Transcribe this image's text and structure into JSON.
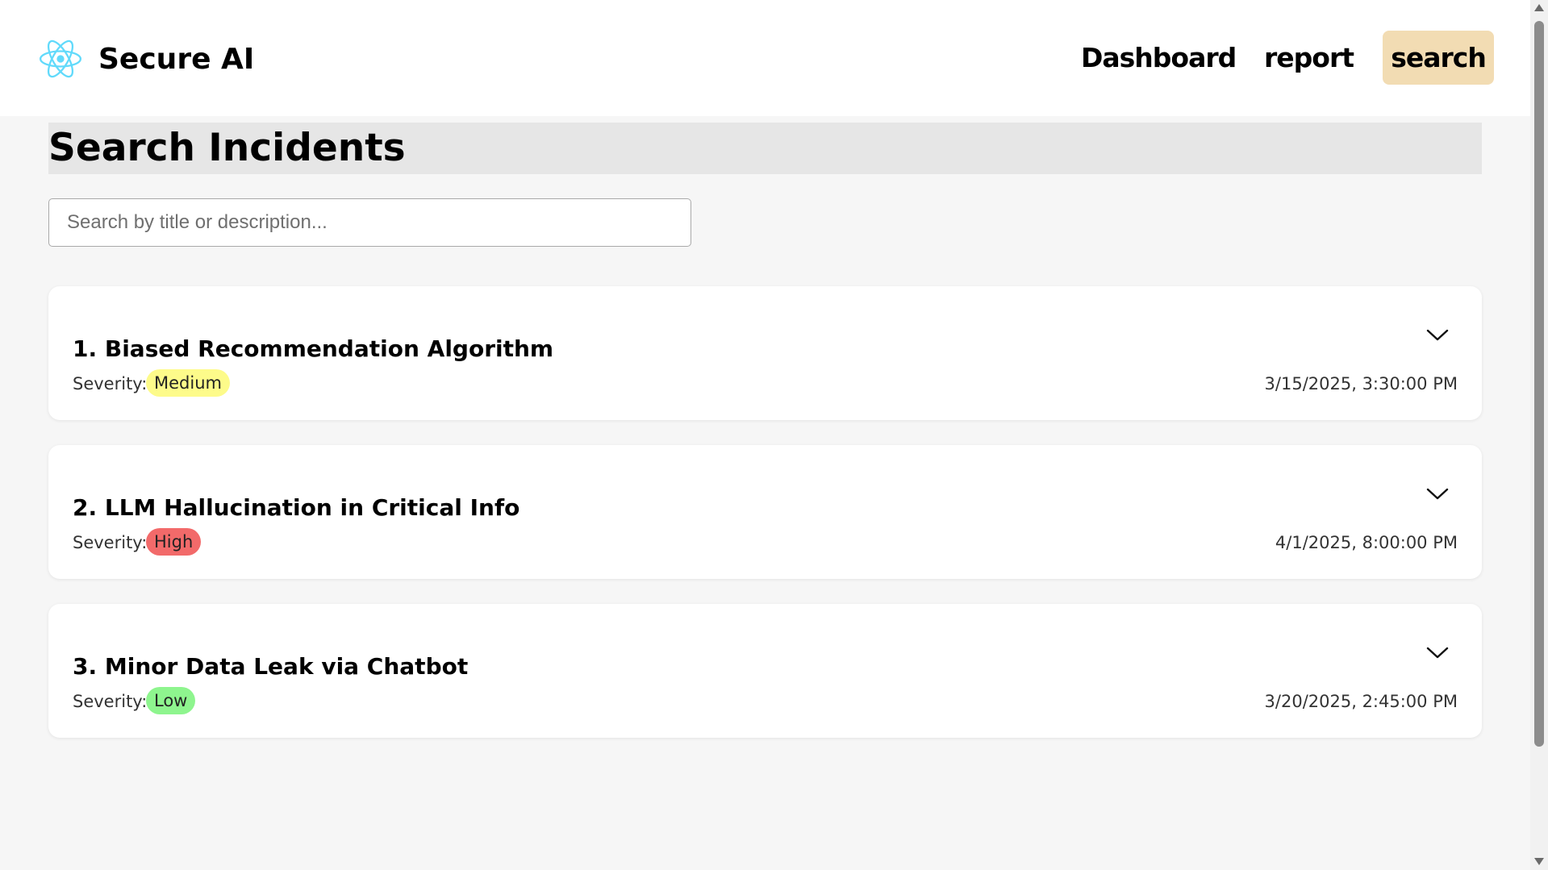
{
  "header": {
    "brand": "Secure AI",
    "logo_icon": "react-atom-icon",
    "logo_color": "#61dafb",
    "nav": {
      "dashboard": "Dashboard",
      "report": "report",
      "search": "search",
      "active": "search",
      "active_color": "#f2dcb3"
    }
  },
  "main": {
    "title": "Search Incidents",
    "search": {
      "placeholder": "Search by title or description...",
      "value": ""
    },
    "severity_label": "Severity:",
    "incidents": [
      {
        "title": "1. Biased Recommendation Algorithm",
        "severity": "Medium",
        "severity_color": "#fdfb8a",
        "reported_at": "3/15/2025, 3:30:00 PM",
        "toggle_icon": "chevron-down-icon"
      },
      {
        "title": "2. LLM Hallucination in Critical Info",
        "severity": "High",
        "severity_color": "#f26a6a",
        "reported_at": "4/1/2025, 8:00:00 PM",
        "toggle_icon": "chevron-down-icon"
      },
      {
        "title": "3. Minor Data Leak via Chatbot",
        "severity": "Low",
        "severity_color": "#8ef58e",
        "reported_at": "3/20/2025, 2:45:00 PM",
        "toggle_icon": "chevron-down-icon"
      }
    ]
  }
}
